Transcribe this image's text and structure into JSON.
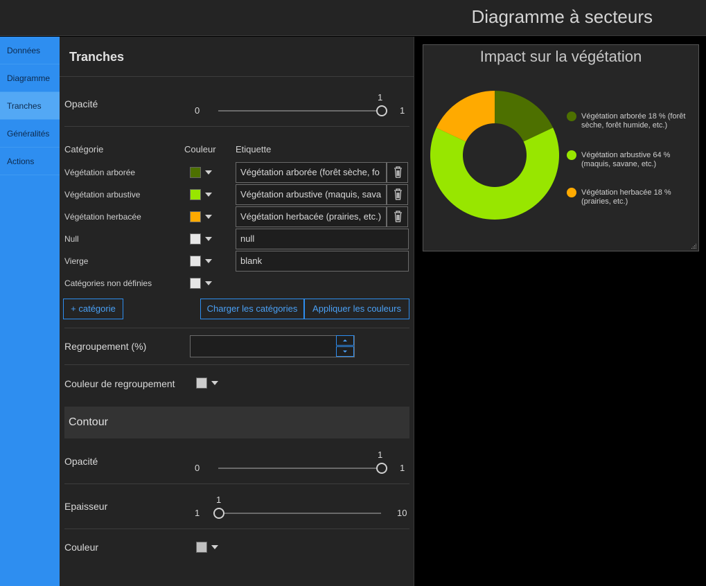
{
  "app": {
    "title": "Diagramme à secteurs"
  },
  "sidenav": {
    "items": [
      {
        "label": "Données"
      },
      {
        "label": "Diagramme"
      },
      {
        "label": "Tranches"
      },
      {
        "label": "Généralités"
      },
      {
        "label": "Actions"
      }
    ],
    "active": "Tranches"
  },
  "panel": {
    "title": "Tranches",
    "opacity": {
      "label": "Opacité",
      "min": "0",
      "max": "1",
      "value": "1"
    },
    "categories": {
      "headers": {
        "category": "Catégorie",
        "color": "Couleur",
        "label": "Etiquette"
      },
      "rows": [
        {
          "name": "Végétation arborée",
          "color": "#4d7000",
          "label": "Végétation arborée (forêt sèche, fo",
          "deletable": true
        },
        {
          "name": "Végétation arbustive",
          "color": "#98e600",
          "label": "Végétation arbustive (maquis, sava",
          "deletable": true
        },
        {
          "name": "Végétation herbacée",
          "color": "#ffaa00",
          "label": "Végétation herbacée (prairies, etc.)",
          "deletable": true
        },
        {
          "name": "Null",
          "color": "#e6e6e6",
          "label": "null",
          "deletable": false
        },
        {
          "name": "Vierge",
          "color": "#e6e6e6",
          "label": "blank",
          "deletable": false
        },
        {
          "name": "Catégories non définies",
          "color": "#e6e6e6",
          "label": "",
          "deletable": false
        }
      ]
    },
    "buttons": {
      "add_category": "+ catégorie",
      "load_categories": "Charger les catégories",
      "apply_colors": "Appliquer les couleurs"
    },
    "grouping": {
      "label": "Regroupement (%)",
      "value": ""
    },
    "grouping_color": {
      "label": "Couleur de regroupement",
      "color": "#cccccc"
    },
    "outline": {
      "title": "Contour",
      "opacity": {
        "label": "Opacité",
        "min": "0",
        "max": "1",
        "value": "1"
      },
      "thickness": {
        "label": "Epaisseur",
        "min": "1",
        "max": "10",
        "value": "1"
      },
      "color": {
        "label": "Couleur",
        "color": "#c0c0c0"
      }
    }
  },
  "chart_data": {
    "type": "pie",
    "title": "Impact sur la végétation",
    "donut": true,
    "legend_position": "right",
    "slices": [
      {
        "name": "Végétation arborée",
        "legend_text": "Végétation arborée  18 % (forêt sèche, forêt humide, etc.)",
        "percent": 18,
        "color": "#4d7000"
      },
      {
        "name": "Végétation arbustive",
        "legend_text": "Végétation arbustive  64 % (maquis, savane, etc.)",
        "percent": 64,
        "color": "#98e600"
      },
      {
        "name": "Végétation herbacée",
        "legend_text": "Végétation herbacée  18 % (prairies, etc.)",
        "percent": 18,
        "color": "#ffaa00"
      }
    ]
  }
}
